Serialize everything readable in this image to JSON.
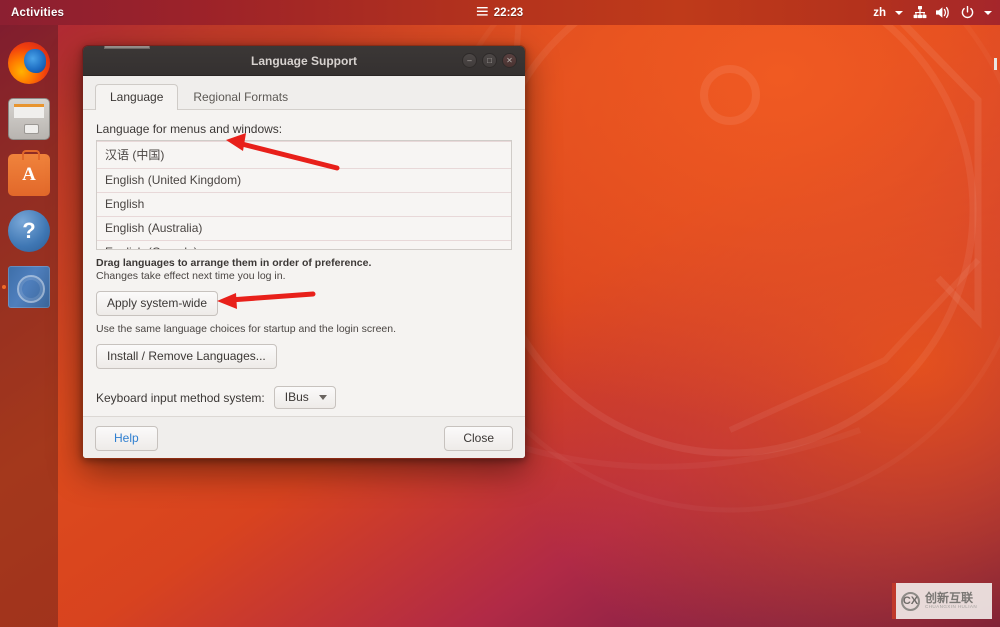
{
  "topbar": {
    "activities": "Activities",
    "clock": "22:23",
    "calendar_icon": "hamburger-menu-icon",
    "keyboard_layout": "zh",
    "network_icon": "network-wired-icon",
    "volume_icon": "volume-high-icon",
    "power_icon": "power-icon",
    "menu_arrow_icon": "chevron-down-icon"
  },
  "dock": {
    "items": [
      {
        "name": "firefox",
        "label": "Firefox Web Browser",
        "running": false
      },
      {
        "name": "files",
        "label": "Files",
        "running": false
      },
      {
        "name": "software",
        "label": "Ubuntu Software",
        "running": false
      },
      {
        "name": "help",
        "label": "Help",
        "running": false
      },
      {
        "name": "language-support",
        "label": "Language Support",
        "running": true
      }
    ]
  },
  "window": {
    "title": "Language Support",
    "buttons": {
      "minimize": "minimize-icon",
      "maximize": "maximize-icon",
      "close": "close-icon"
    },
    "tabs": [
      {
        "label": "Language",
        "active": true
      },
      {
        "label": "Regional Formats",
        "active": false
      }
    ],
    "language_section": {
      "label": "Language for menus and windows:",
      "languages": [
        "汉语 (中国)",
        "English (United Kingdom)",
        "English",
        "English (Australia)",
        "English (Canada)"
      ],
      "hint_strong": "Drag languages to arrange them in order of preference.",
      "hint": "Changes take effect next time you log in.",
      "apply_button": "Apply system-wide",
      "apply_note": "Use the same language choices for startup and the login screen.",
      "install_button": "Install / Remove Languages..."
    },
    "input_method": {
      "label": "Keyboard input method system:",
      "value": "IBus"
    },
    "footer": {
      "help": "Help",
      "close": "Close"
    }
  },
  "annotations": [
    {
      "name": "arrow-to-language-list",
      "color": "#e8201a"
    },
    {
      "name": "arrow-to-apply-system-wide",
      "color": "#e8201a"
    }
  ],
  "watermark": {
    "cn": "创新互联",
    "en": "CHUANGXIN HULIAN",
    "mark": "CX"
  },
  "colors": {
    "accent": "#e8201a",
    "topbar": "#a5262b",
    "desktop_orange": "#dd4b1d",
    "desktop_purple": "#5c1240",
    "link": "#2f7fd0"
  }
}
